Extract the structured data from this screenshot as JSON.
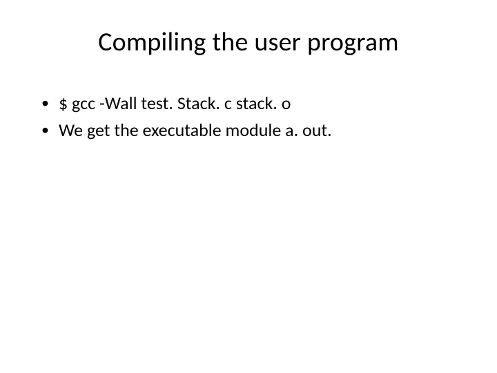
{
  "slide": {
    "title": "Compiling the user program",
    "bullets": [
      "$ gcc -Wall test. Stack. c stack. o",
      "We get the executable module a. out."
    ]
  }
}
